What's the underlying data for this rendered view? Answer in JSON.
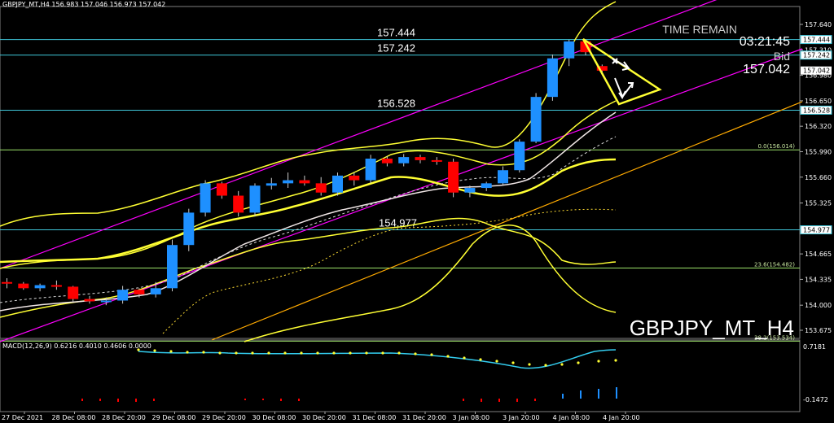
{
  "window": {
    "header": "GBPJPY_MT,H4   156.983 157.046 156.973 157.042"
  },
  "symbol_label": "GBPJPY_MT_H4",
  "time_remain": {
    "label": "TIME REMAIN",
    "value": "03:21:45"
  },
  "bid": {
    "label": "Bid",
    "value": "157.042"
  },
  "levels": [
    {
      "label": "157.444",
      "price": 157.444,
      "tag": "157.444"
    },
    {
      "label": "157.242",
      "price": 157.242,
      "tag": "157.242"
    },
    {
      "label": "156.528",
      "price": 156.528,
      "tag": "156.528"
    },
    {
      "label": "154.977",
      "price": 154.977,
      "tag": "154.977"
    }
  ],
  "current_price_tag": "157.042",
  "fibo": [
    {
      "label": "0.0(156.014)",
      "price": 156.014
    },
    {
      "label": "23.6(154.482)",
      "price": 154.482
    },
    {
      "label": "38.2(153.534)",
      "price": 153.534
    }
  ],
  "price_axis": [
    "157.640",
    "157.310",
    "156.980",
    "156.650",
    "156.320",
    "155.990",
    "155.660",
    "155.325",
    "154.995",
    "154.665",
    "154.335",
    "154.000",
    "153.675"
  ],
  "macd": {
    "label": "MACD(12,26,9) 0.6216 0.4010 0.4606 0.0000",
    "axis_top": "0.7181",
    "axis_bottom": "-0.1472"
  },
  "time_axis": [
    "27 Dec 2021",
    "28 Dec 08:00",
    "28 Dec 20:00",
    "29 Dec 08:00",
    "29 Dec 20:00",
    "30 Dec 08:00",
    "30 Dec 20:00",
    "31 Dec 08:00",
    "31 Dec 20:00",
    "3 Jan 08:00",
    "3 Jan 20:00",
    "4 Jan 08:00",
    "4 Jan 20:00"
  ],
  "colors": {
    "bull": "#1e90ff",
    "bear": "#ff0000",
    "bollinger": "#ffff33",
    "channel": "#ff00ff",
    "trendline": "#ffaa00",
    "levels": "#3fc6d8",
    "fibo": "#9be36a",
    "macd": "#33ccee"
  },
  "chart_data": {
    "type": "candlestick",
    "series": [
      {
        "name": "GBPJPY_MT,H4",
        "candles": [
          [
            154.3,
            154.35,
            154.22,
            154.28
          ],
          [
            154.28,
            154.3,
            154.2,
            154.22
          ],
          [
            154.22,
            154.28,
            154.18,
            154.26
          ],
          [
            154.26,
            154.32,
            154.2,
            154.24
          ],
          [
            154.24,
            154.25,
            154.05,
            154.08
          ],
          [
            154.08,
            154.12,
            154.02,
            154.05
          ],
          [
            154.05,
            154.1,
            154.0,
            154.06
          ],
          [
            154.06,
            154.25,
            154.02,
            154.2
          ],
          [
            154.2,
            154.22,
            154.1,
            154.14
          ],
          [
            154.14,
            154.3,
            154.1,
            154.22
          ],
          [
            154.22,
            154.85,
            154.18,
            154.78
          ],
          [
            154.78,
            155.25,
            154.7,
            155.2
          ],
          [
            155.2,
            155.62,
            155.15,
            155.58
          ],
          [
            155.58,
            155.6,
            155.38,
            155.42
          ],
          [
            155.42,
            155.48,
            155.15,
            155.2
          ],
          [
            155.2,
            155.58,
            155.15,
            155.55
          ],
          [
            155.55,
            155.65,
            155.5,
            155.58
          ],
          [
            155.58,
            155.72,
            155.52,
            155.62
          ],
          [
            155.62,
            155.68,
            155.55,
            155.58
          ],
          [
            155.58,
            155.66,
            155.42,
            155.46
          ],
          [
            155.46,
            155.72,
            155.42,
            155.68
          ],
          [
            155.68,
            155.72,
            155.55,
            155.62
          ],
          [
            155.62,
            155.95,
            155.58,
            155.9
          ],
          [
            155.9,
            155.93,
            155.8,
            155.84
          ],
          [
            155.84,
            155.96,
            155.8,
            155.92
          ],
          [
            155.92,
            155.95,
            155.84,
            155.88
          ],
          [
            155.88,
            155.92,
            155.82,
            155.86
          ],
          [
            155.86,
            155.9,
            155.4,
            155.46
          ],
          [
            155.46,
            155.55,
            155.4,
            155.52
          ],
          [
            155.52,
            155.6,
            155.48,
            155.58
          ],
          [
            155.58,
            155.8,
            155.55,
            155.75
          ],
          [
            155.75,
            156.15,
            155.72,
            156.12
          ],
          [
            156.12,
            156.75,
            156.1,
            156.7
          ],
          [
            156.7,
            157.25,
            156.65,
            157.2
          ],
          [
            157.2,
            157.44,
            157.1,
            157.42
          ],
          [
            157.42,
            157.44,
            157.24,
            157.28
          ],
          [
            157.1,
            157.12,
            157.02,
            157.04
          ]
        ]
      }
    ],
    "xlabel": "",
    "ylabel": "",
    "ylim": [
      153.6,
      157.8
    ]
  }
}
